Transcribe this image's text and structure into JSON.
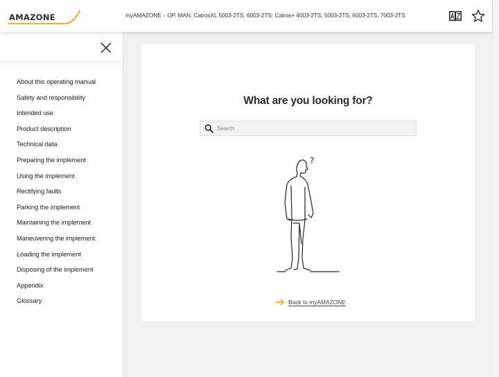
{
  "header": {
    "logo_text": "AMAZONE",
    "breadcrumb": [
      "myAMAZONE",
      "OP. MAN. CatrosXL 5003-2TS, 6003-2TS; Catros+ 4003-2TS, 5003-2TS, 6003-2TS, 7003-2TS"
    ],
    "breadcrumb_sep": "›",
    "icons": [
      "glossary-az-icon",
      "star-icon"
    ]
  },
  "sidebar": {
    "close_icon": "close-icon",
    "items": [
      {
        "label": "About this operating manual"
      },
      {
        "label": "Safety and responsibility"
      },
      {
        "label": "Intended use"
      },
      {
        "label": "Product description"
      },
      {
        "label": "Technical data"
      },
      {
        "label": "Preparing the implement"
      },
      {
        "label": "Using the implement"
      },
      {
        "label": "Rectifying faults"
      },
      {
        "label": "Parking the implement"
      },
      {
        "label": "Maintaining the implement"
      },
      {
        "label": "Maneuvering the implement"
      },
      {
        "label": "Loading the implement"
      },
      {
        "label": "Disposing of the implement"
      },
      {
        "label": "Appendix"
      },
      {
        "label": "Glossary"
      }
    ]
  },
  "main": {
    "heading": "What are you looking for?",
    "search": {
      "placeholder": "Search",
      "value": ""
    },
    "back_link": "Back to myAMAZONE",
    "figure_mark": "?"
  },
  "colors": {
    "accent": "#f29400",
    "text": "#222222",
    "background": "#f0f0f0"
  }
}
